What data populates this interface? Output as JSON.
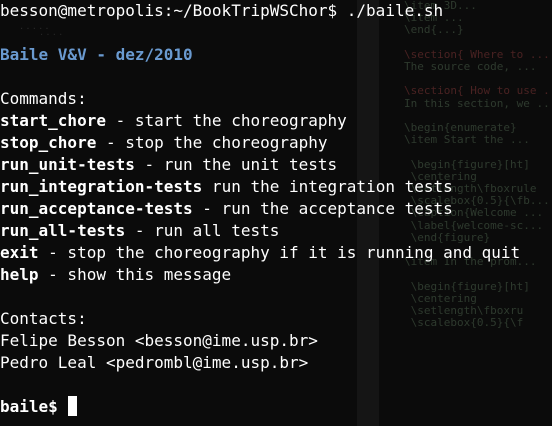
{
  "terminal": {
    "prompt_line": "besson@metropolis:~/BookTripWSChor$ ./baile.sh",
    "title": "Baile V&V - dez/2010",
    "commands_heading": "Commands:",
    "commands": [
      {
        "name": "start_chore",
        "desc": " - start the choreography"
      },
      {
        "name": "stop_chore",
        "desc": " - stop the choreography"
      },
      {
        "name": "run_unit-tests",
        "desc": " - run the unit tests"
      },
      {
        "name": "run_integration-tests",
        "desc": " run the integration tests"
      },
      {
        "name": "run_acceptance-tests",
        "desc": " - run the acceptance tests"
      },
      {
        "name": "run_all-tests",
        "desc": " - run all tests"
      },
      {
        "name": "exit",
        "desc": " - stop the choreography if it is running and quit"
      },
      {
        "name": "help",
        "desc": " - show this message"
      }
    ],
    "contacts_heading": "Contacts:",
    "contacts": [
      "Felipe Besson <besson@ime.usp.br>",
      "Pedro Leal <pedrombl@ime.usp.br>"
    ],
    "shell_prompt": "baile$ "
  },
  "colors": {
    "background": "#0b0b0b",
    "text": "#ffffff",
    "title": "#6a9ad0"
  }
}
